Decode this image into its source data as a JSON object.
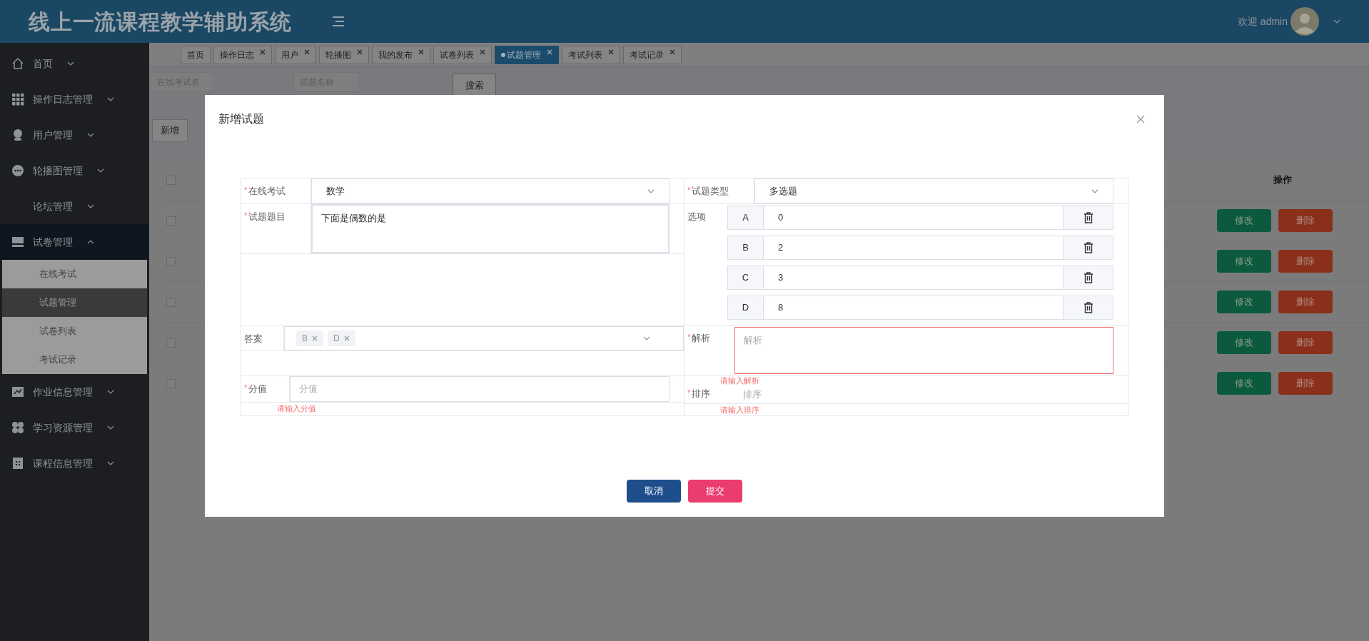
{
  "header": {
    "title": "线上一流课程教学辅助系统",
    "welcome": "欢迎 admin"
  },
  "sidebar": {
    "items": [
      {
        "label": "首页",
        "kind": "home",
        "expanded": false
      },
      {
        "label": "操作日志管理",
        "kind": "grid",
        "expanded": false
      },
      {
        "label": "用户管理",
        "kind": "user",
        "expanded": false
      },
      {
        "label": "轮播图管理",
        "kind": "dots",
        "expanded": false
      },
      {
        "label": "论坛管理",
        "kind": "plain",
        "expanded": false
      },
      {
        "label": "试卷管理",
        "kind": "paper",
        "expanded": true,
        "children": [
          {
            "label": "在线考试",
            "selected": false
          },
          {
            "label": "试题管理",
            "selected": true
          },
          {
            "label": "试卷列表",
            "selected": false
          },
          {
            "label": "考试记录",
            "selected": false
          }
        ]
      },
      {
        "label": "作业信息管理",
        "kind": "chart",
        "expanded": false
      },
      {
        "label": "学习资源管理",
        "kind": "clover",
        "expanded": false
      },
      {
        "label": "课程信息管理",
        "kind": "building",
        "expanded": false
      }
    ]
  },
  "tabs": [
    {
      "label": "首页",
      "selected": false,
      "closable": false
    },
    {
      "label": "操作日志",
      "selected": false,
      "closable": true
    },
    {
      "label": "用户",
      "selected": false,
      "closable": true
    },
    {
      "label": "轮播图",
      "selected": false,
      "closable": true
    },
    {
      "label": "我的发布",
      "selected": false,
      "closable": true
    },
    {
      "label": "试卷列表",
      "selected": false,
      "closable": true
    },
    {
      "label": "试题管理",
      "selected": true,
      "closable": true
    },
    {
      "label": "考试列表",
      "selected": false,
      "closable": true
    },
    {
      "label": "考试记录",
      "selected": false,
      "closable": true
    }
  ],
  "search": {
    "fields": [
      {
        "placeholder": "在线考试名"
      },
      {
        "placeholder": "试题名称"
      }
    ],
    "button": "搜索"
  },
  "toolbar": {
    "add_button": "新增"
  },
  "table": {
    "header_checked": false,
    "action_column": "操作",
    "rows": [
      {
        "checked": false,
        "edit": "修改",
        "delete": "删除"
      },
      {
        "checked": false,
        "edit": "修改",
        "delete": "删除"
      },
      {
        "checked": false,
        "edit": "修改",
        "delete": "删除"
      },
      {
        "checked": false,
        "edit": "修改",
        "delete": "删除"
      },
      {
        "checked": false,
        "edit": "修改",
        "delete": "删除"
      }
    ]
  },
  "modal": {
    "title": "新增试题",
    "exam": {
      "mark": "*",
      "label": "在线考试",
      "value": "数学"
    },
    "type": {
      "mark": "*",
      "label": "试题类型",
      "value": "多选题"
    },
    "question": {
      "mark": "*",
      "label": "试题题目",
      "value": "下面是偶数的是"
    },
    "options": {
      "label": "选项",
      "items": [
        {
          "letter": "A",
          "value": "0"
        },
        {
          "letter": "B",
          "value": "2"
        },
        {
          "letter": "C",
          "value": "3"
        },
        {
          "letter": "D",
          "value": "8"
        }
      ]
    },
    "answer": {
      "label": "答案",
      "tags": [
        "B",
        "D"
      ]
    },
    "analysis": {
      "mark": "*",
      "label": "解析",
      "placeholder": "解析",
      "error": "请输入解析"
    },
    "score": {
      "mark": "*",
      "label": "分值",
      "placeholder": "分值",
      "error": "请输入分值"
    },
    "sort": {
      "mark": "*",
      "label": "排序",
      "placeholder": "排序",
      "error": "请输入排序"
    },
    "buttons": {
      "cancel": "取消",
      "submit": "提交"
    }
  }
}
